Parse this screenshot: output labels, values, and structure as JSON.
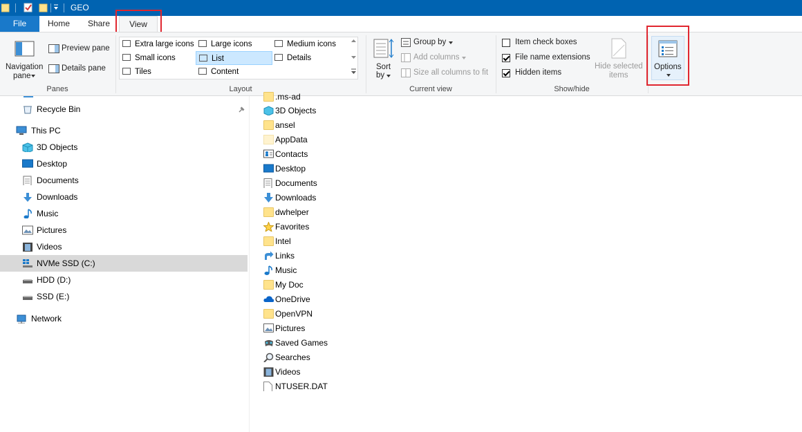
{
  "window": {
    "title": "GEO"
  },
  "ribbon_tabs": {
    "file": "File",
    "home": "Home",
    "share": "Share",
    "view": "View"
  },
  "panes": {
    "navigation_pane_line1": "Navigation",
    "navigation_pane_line2": "pane",
    "preview_pane": "Preview pane",
    "details_pane": "Details pane",
    "group_label": "Panes"
  },
  "layout": {
    "extra_large_icons": "Extra large icons",
    "large_icons": "Large icons",
    "medium_icons": "Medium icons",
    "small_icons": "Small icons",
    "list": "List",
    "details": "Details",
    "tiles": "Tiles",
    "content": "Content",
    "group_label": "Layout"
  },
  "current_view": {
    "sort_by_line1": "Sort",
    "sort_by_line2": "by",
    "group_by": "Group by",
    "add_columns": "Add columns",
    "size_all_columns": "Size all columns to fit",
    "group_label": "Current view"
  },
  "show_hide": {
    "item_check_boxes": "Item check boxes",
    "item_check_boxes_checked": false,
    "file_name_extensions": "File name extensions",
    "file_name_extensions_checked": true,
    "hidden_items": "Hidden items",
    "hidden_items_checked": true,
    "hide_selected_line1": "Hide selected",
    "hide_selected_line2": "items",
    "group_label": "Show/hide"
  },
  "options": {
    "label": "Options"
  },
  "nav": {
    "recycle_bin": "Recycle Bin",
    "this_pc": "This PC",
    "objects_3d": "3D Objects",
    "desktop": "Desktop",
    "documents": "Documents",
    "downloads": "Downloads",
    "music": "Music",
    "pictures": "Pictures",
    "videos": "Videos",
    "nvme": "NVMe SSD (C:)",
    "hdd": "HDD (D:)",
    "ssd": "SSD (E:)",
    "network": "Network"
  },
  "files": [
    {
      "name": ".ms-ad",
      "icon": "folder-icon"
    },
    {
      "name": "3D Objects",
      "icon": "3d-objects-icon"
    },
    {
      "name": "ansel",
      "icon": "folder-icon"
    },
    {
      "name": "AppData",
      "icon": "hidden-folder-icon"
    },
    {
      "name": "Contacts",
      "icon": "contacts-icon"
    },
    {
      "name": "Desktop",
      "icon": "desktop-icon"
    },
    {
      "name": "Documents",
      "icon": "documents-icon"
    },
    {
      "name": "Downloads",
      "icon": "downloads-icon"
    },
    {
      "name": "dwhelper",
      "icon": "folder-icon"
    },
    {
      "name": "Favorites",
      "icon": "star-icon"
    },
    {
      "name": "Intel",
      "icon": "folder-icon"
    },
    {
      "name": "Links",
      "icon": "links-icon"
    },
    {
      "name": "Music",
      "icon": "music-icon"
    },
    {
      "name": "My Doc",
      "icon": "folder-icon"
    },
    {
      "name": "OneDrive",
      "icon": "cloud-icon"
    },
    {
      "name": "OpenVPN",
      "icon": "folder-icon"
    },
    {
      "name": "Pictures",
      "icon": "pictures-icon"
    },
    {
      "name": "Saved Games",
      "icon": "saved-games-icon"
    },
    {
      "name": "Searches",
      "icon": "search-icon"
    },
    {
      "name": "Videos",
      "icon": "videos-icon"
    },
    {
      "name": "NTUSER.DAT",
      "icon": "file-icon"
    }
  ],
  "colors": {
    "titlebar": "#0063b1",
    "file_tab": "#1979ca",
    "highlight_box": "#e0262f",
    "selection": "#cce8ff"
  }
}
